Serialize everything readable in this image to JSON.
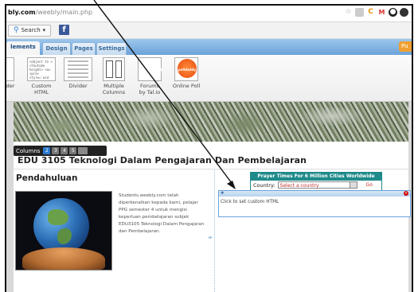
{
  "browser": {
    "url_host": "bly.com",
    "url_path": "/weebly/main.php",
    "icons": [
      "star-icon",
      "extension-icon",
      "extension-icon",
      "mail-icon",
      "extension-icon",
      "extension-icon"
    ]
  },
  "toolbar": {
    "search_label": "Search"
  },
  "tabs": {
    "items": [
      {
        "label": "lements"
      },
      {
        "label": "Design"
      },
      {
        "label": "Pages"
      },
      {
        "label": "Settings"
      }
    ],
    "publish_label": "Pu"
  },
  "palette": {
    "items": [
      {
        "label": "der",
        "label2": ""
      },
      {
        "label": "Custom",
        "label2": "HTML"
      },
      {
        "label": "Divider",
        "label2": ""
      },
      {
        "label": "Multiple",
        "label2": "Columns"
      },
      {
        "label": "Forums",
        "label2": "by Tal.io"
      },
      {
        "label": "Online Poll",
        "label2": ""
      }
    ],
    "code_thumb_text": "<object to > <Youtube height> <a> <pre> style='wid <img src= target='_b",
    "talkio_logo": "Talkio",
    "poll_logo": "polldaddy"
  },
  "page": {
    "columns_label": "Columns",
    "column_numbers": [
      "2",
      "3",
      "4",
      "5"
    ],
    "site_title": "EDU 3105 Teknologi Dalam Pengajaran Dan Pembelajaran",
    "heading": "Pendahuluan",
    "paragraph": "Students.weebly.com telah diperkenalkan kepada kami, pelajar PPG semester 4 untuk mengisi keperluan pembelajaran subjek EDU3105 Teknologi Dalam Pengajaran dan Pembelajaran.",
    "prayer_title": "Prayer Times For 6 Million Cities Worldwide",
    "prayer_country_label": "Country:",
    "prayer_select": "Select a country",
    "prayer_go": "Go",
    "custom_html_hint": "Click to set custom HTML"
  },
  "colors": {
    "tab_bar": "#6aa3d9",
    "prayer_teal": "#1f8a8a",
    "columns_active": "#2a7ad0"
  }
}
